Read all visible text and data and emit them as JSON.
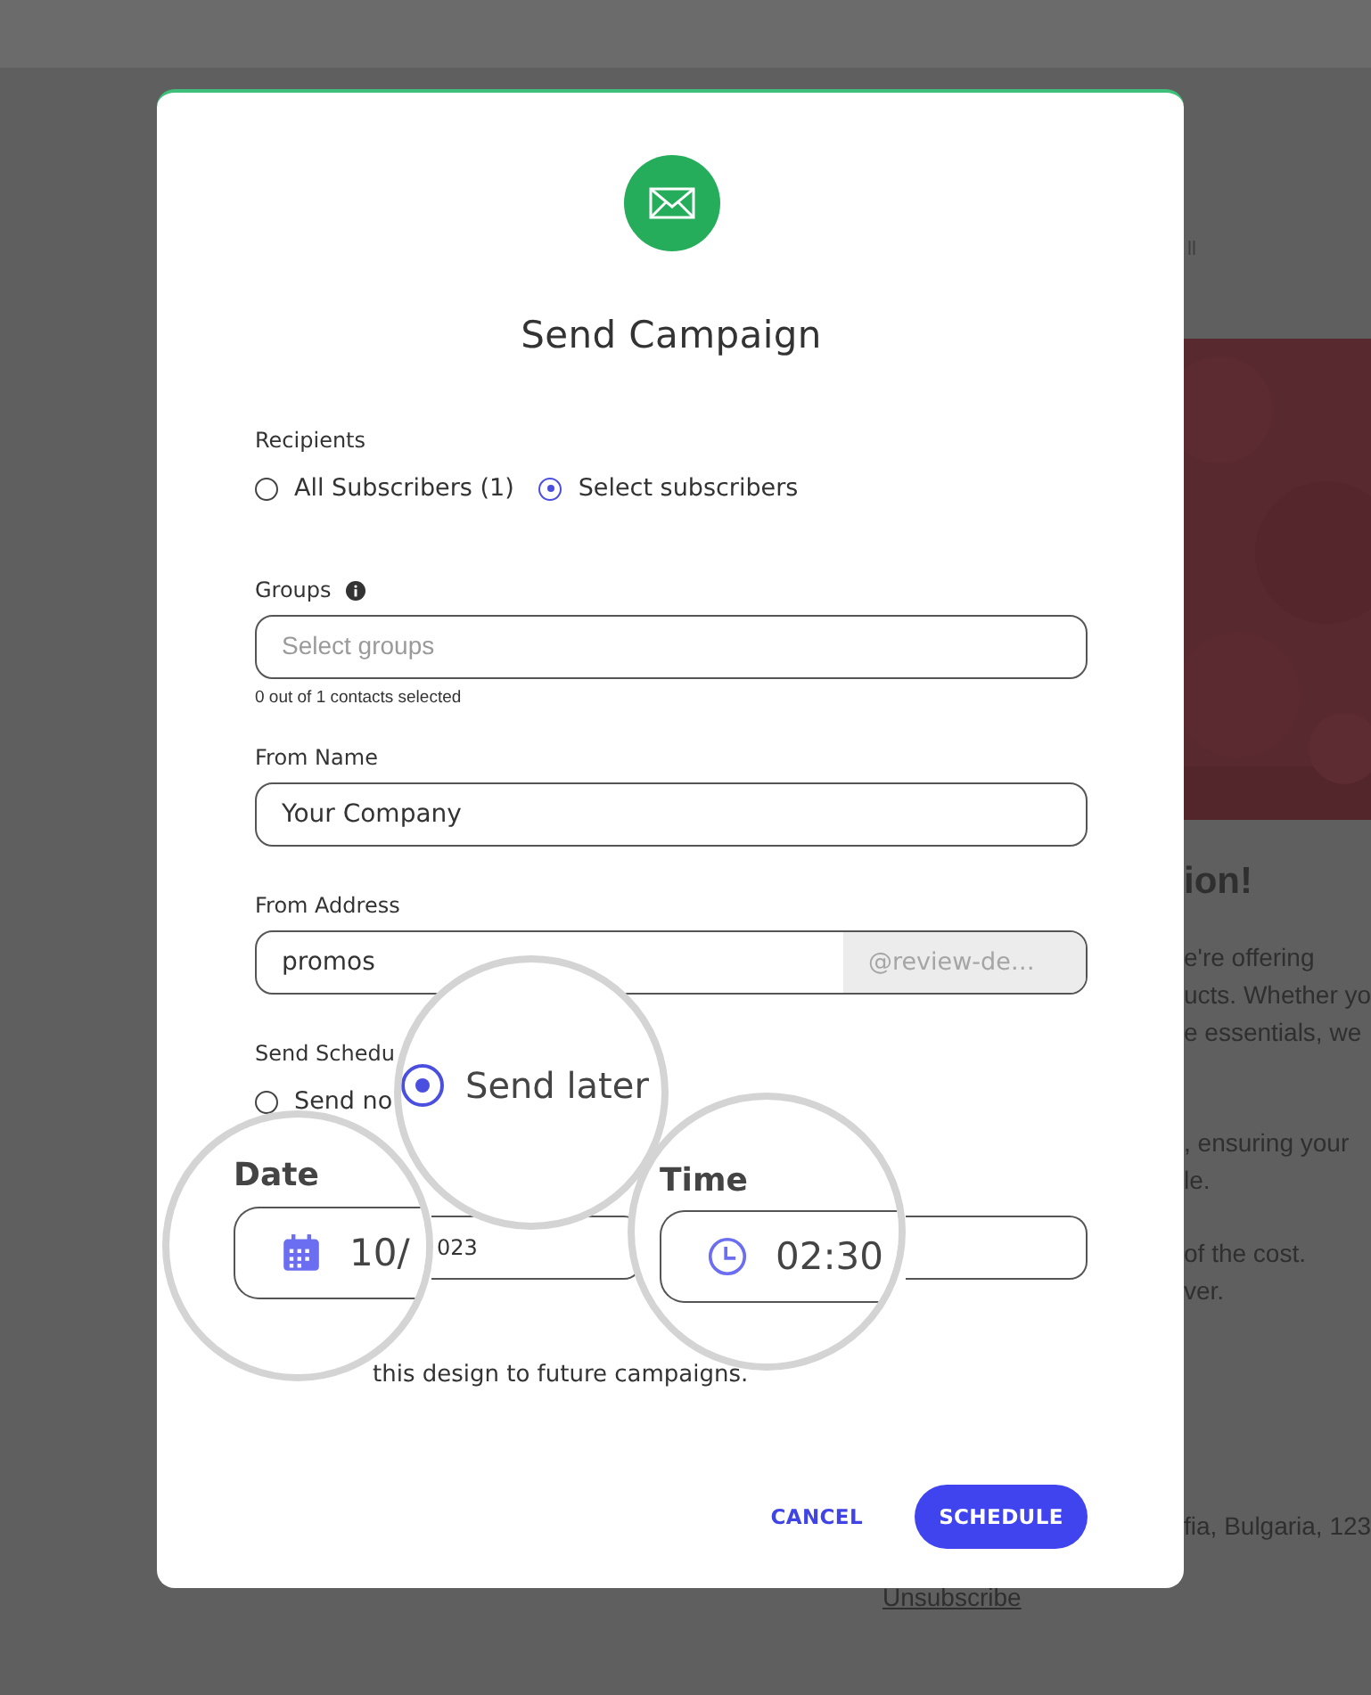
{
  "background_page": {
    "top_text": "ll",
    "heading": "ion!",
    "paragraphs": [
      [
        "e're offering",
        "ucts. Whether yo",
        "e essentials, we"
      ],
      [
        ", ensuring your",
        "le."
      ],
      [
        "of the cost.",
        "ver."
      ]
    ],
    "address": "fia, Bulgaria, 123",
    "link": "Unsubscribe"
  },
  "modal": {
    "title": "Send Campaign",
    "recipients": {
      "label": "Recipients",
      "options": [
        {
          "label": "All Subscribers (1)",
          "selected": false
        },
        {
          "label": "Select subscribers",
          "selected": true
        }
      ]
    },
    "groups": {
      "label": "Groups",
      "placeholder": "Select groups",
      "hint": "0 out of 1 contacts selected"
    },
    "from_name": {
      "label": "From Name",
      "value": "Your Company"
    },
    "from_address": {
      "label": "From Address",
      "value": "promos",
      "suffix": "@review-de…"
    },
    "send_schedule": {
      "label": "Send Schedu",
      "options": [
        {
          "label": "Send no",
          "selected": false
        }
      ]
    },
    "date": {
      "value": "023"
    },
    "save_design": {
      "label": "this design to future campaigns."
    },
    "buttons": [
      {
        "label": "CANCEL",
        "kind": "text"
      },
      {
        "label": "SCHEDULE",
        "kind": "primary"
      }
    ]
  },
  "magnifiers": [
    {
      "kind": "date",
      "label": "Date",
      "value": "10/"
    },
    {
      "kind": "radio",
      "label": "Send later",
      "selected": true
    },
    {
      "kind": "time",
      "label": "Time",
      "value": "02:30"
    }
  ]
}
